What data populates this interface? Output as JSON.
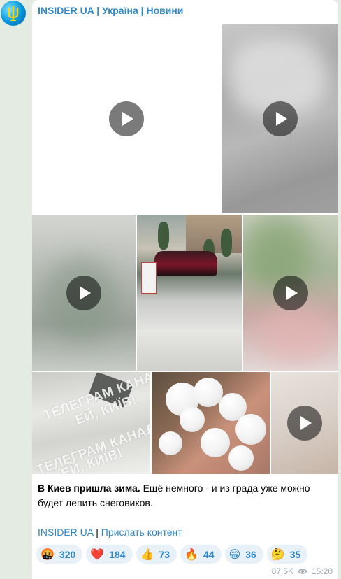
{
  "channel": {
    "name": "INSIDER UA | Україна | Новини"
  },
  "media": {
    "watermark_line1": "ТЕЛЕГРАМ КАНАЛ",
    "watermark_line2": "ЕЙ, КИЇВ!"
  },
  "post": {
    "caption_bold": "В Киев пришла зима.",
    "caption_rest": " Ещё немного - и из града уже можно будет лепить снеговиков.",
    "link_channel": "INSIDER UA",
    "separator": " | ",
    "link_submit": "Прислать контент"
  },
  "reactions": [
    {
      "emoji": "🤬",
      "count": "320"
    },
    {
      "emoji": "❤️",
      "count": "184"
    },
    {
      "emoji": "👍",
      "count": "73"
    },
    {
      "emoji": "🔥",
      "count": "44"
    },
    {
      "emoji": "😁",
      "count": "36"
    },
    {
      "emoji": "🤔",
      "count": "35"
    }
  ],
  "meta": {
    "views": "87.5K",
    "time": "15:20"
  },
  "icons": {
    "avatar": "ukraine-trident-avatar",
    "play": "play-icon",
    "views": "eye-icon"
  },
  "colors": {
    "accent": "#2f87c6",
    "background": "#e4ebe2",
    "reaction_bg": "#e9f1f8"
  }
}
